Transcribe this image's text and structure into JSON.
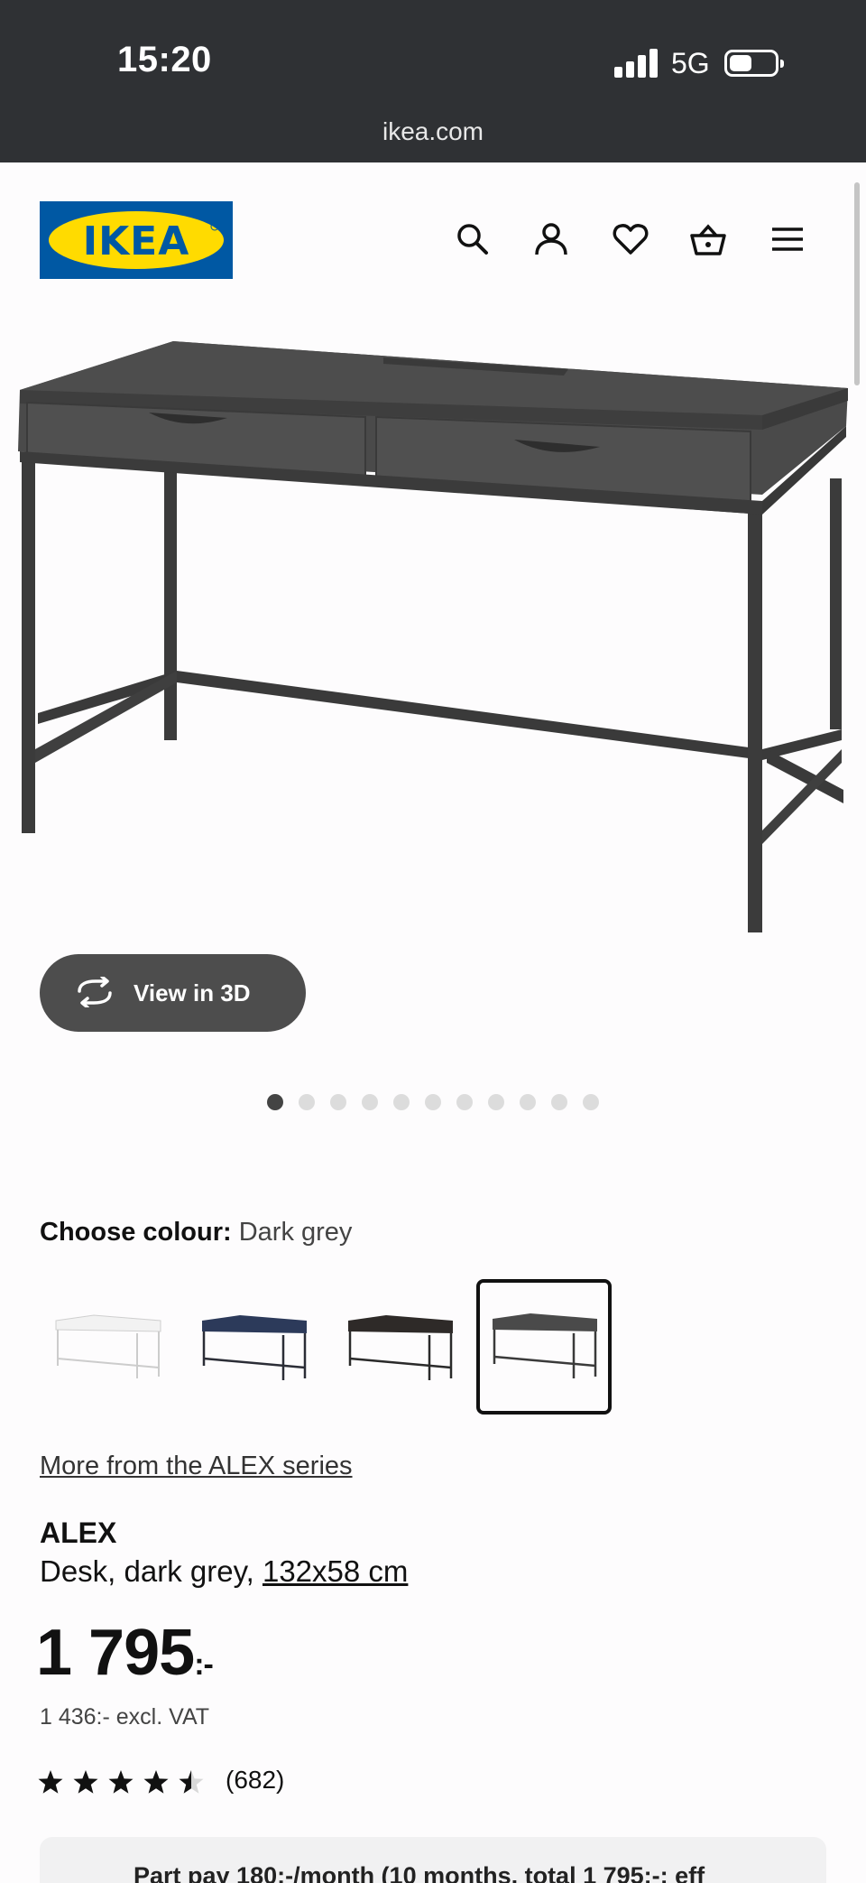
{
  "status_bar": {
    "time": "15:20",
    "network": "5G"
  },
  "browser": {
    "url": "ikea.com"
  },
  "header": {
    "logo_text": "IKEA",
    "icons": [
      "search-icon",
      "account-icon",
      "heart-icon",
      "basket-icon",
      "menu-icon"
    ]
  },
  "gallery": {
    "view_3d_label": "View in 3D",
    "image_count": 11,
    "active_index": 0
  },
  "colour": {
    "label": "Choose colour:",
    "selected": "Dark grey",
    "swatches": [
      "white",
      "blue",
      "black-brown",
      "dark grey"
    ],
    "selected_index": 3
  },
  "series_link": "More from the ALEX series",
  "product": {
    "name": "ALEX",
    "description": "Desk, dark grey, ",
    "dimensions": "132x58 cm",
    "price": "1 795",
    "price_suffix": ":-",
    "price_excl_vat": "1 436:- excl. VAT",
    "rating": 4.5,
    "rating_max": 5,
    "reviews": "(682)"
  },
  "payment": {
    "text": "Part pay 180:-/month (10 months, total 1 795:-; eff"
  },
  "colors": {
    "status_bg": "#2f3134",
    "ikea_blue": "#0058a3",
    "ikea_yellow": "#ffdb00",
    "desk": "#4a4a4a"
  }
}
